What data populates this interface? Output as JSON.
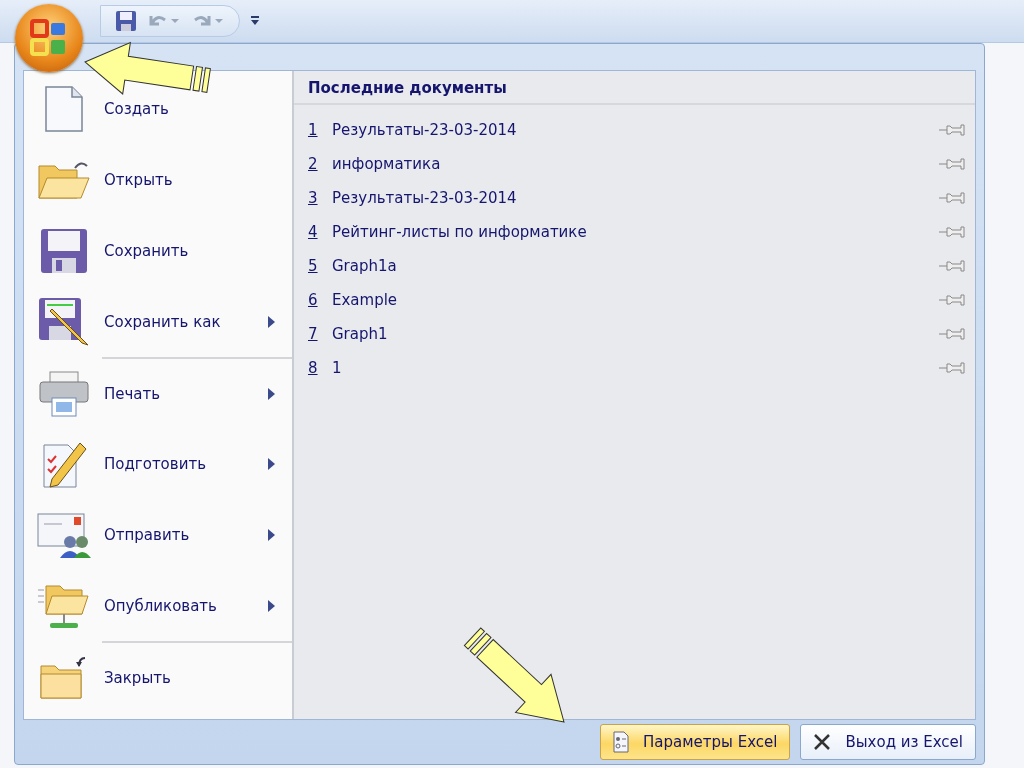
{
  "menu": {
    "items": [
      {
        "label": "Создать",
        "has_submenu": false,
        "separated": false
      },
      {
        "label": "Открыть",
        "has_submenu": false,
        "separated": false
      },
      {
        "label": "Сохранить",
        "has_submenu": false,
        "separated": false
      },
      {
        "label": "Сохранить как",
        "has_submenu": true,
        "separated": false
      },
      {
        "label": "Печать",
        "has_submenu": true,
        "separated": true
      },
      {
        "label": "Подготовить",
        "has_submenu": true,
        "separated": false
      },
      {
        "label": "Отправить",
        "has_submenu": true,
        "separated": false
      },
      {
        "label": "Опубликовать",
        "has_submenu": true,
        "separated": false
      },
      {
        "label": "Закрыть",
        "has_submenu": false,
        "separated": true
      }
    ]
  },
  "recent_documents": {
    "title": "Последние документы",
    "items": [
      {
        "number": "1",
        "name": "Результаты-23-03-2014"
      },
      {
        "number": "2",
        "name": "информатика"
      },
      {
        "number": "3",
        "name": "Результаты-23-03-2014"
      },
      {
        "number": "4",
        "name": "Рейтинг-листы по информатике"
      },
      {
        "number": "5",
        "name": "Graph1a"
      },
      {
        "number": "6",
        "name": "Example"
      },
      {
        "number": "7",
        "name": "Graph1"
      },
      {
        "number": "8",
        "name": "1"
      }
    ]
  },
  "footer_buttons": [
    {
      "label": "Параметры Excel",
      "kind": "options",
      "selected": true
    },
    {
      "label": "Выход из Excel",
      "kind": "exit",
      "selected": false
    }
  ]
}
